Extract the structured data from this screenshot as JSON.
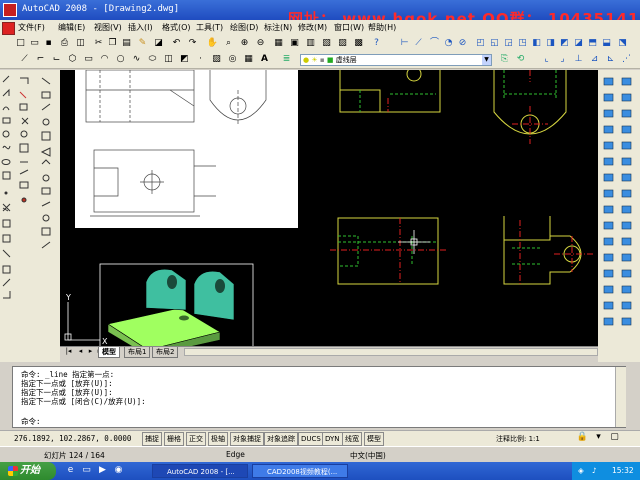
{
  "titlebar": {
    "title": "AutoCAD 2008 - [Drawing2.dwg]",
    "watermark": "网址： www.hqok.net  QQ群： 10435141"
  },
  "menubar": {
    "items": [
      "文件(F)",
      "编辑(E)",
      "视图(V)",
      "插入(I)",
      "格式(O)",
      "工具(T)",
      "绘图(D)",
      "标注(N)",
      "修改(M)",
      "窗口(W)",
      "帮助(H)"
    ]
  },
  "layers": {
    "layer_name": "虚线层",
    "color_combo": "0"
  },
  "canvas": {
    "axis_x": "X",
    "axis_y": "Y"
  },
  "tabs": [
    "模型",
    "布局1",
    "布局2"
  ],
  "command": {
    "lines": [
      "命令: _line 指定第一点:",
      "指定下一点或 [放弃(U)]:",
      "指定下一点或 [放弃(U)]:",
      "指定下一点或 [闭合(C)/放弃(U)]:"
    ],
    "prompt": "命令:"
  },
  "status": {
    "coords": "276.1892, 102.2867, 0.0000",
    "buttons": [
      "捕捉",
      "栅格",
      "正交",
      "极轴",
      "对象捕捉",
      "对象追踪",
      "DUCS",
      "DYN",
      "线宽",
      "模型"
    ],
    "scale_label": "注释比例:",
    "scale_value": "1:1"
  },
  "infobar": {
    "slide": "幻灯片 124 / 164",
    "edge": "Edge",
    "lang": "中文(中国)"
  },
  "taskbar": {
    "start": "开始",
    "tasks": [
      "AutoCAD 2008 - [...",
      "CAD2008视频教程(..."
    ],
    "time": "15:32"
  },
  "colors": {
    "model_green": "#3fbfa0",
    "drawing_yellow": "#d6d640",
    "hidden_green": "#30c030",
    "center_red": "#e02020",
    "crosshair": "#ffffff"
  }
}
